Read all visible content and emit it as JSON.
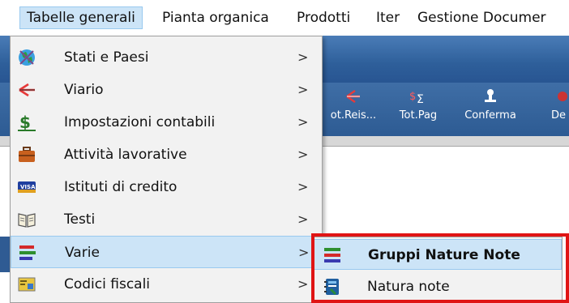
{
  "menubar": {
    "items": [
      {
        "label": "Tabelle generali"
      },
      {
        "label": "Pianta organica"
      },
      {
        "label": "Prodotti"
      },
      {
        "label": "Iter"
      },
      {
        "label": "Gestione Documer"
      }
    ]
  },
  "toolbar": {
    "buttons": [
      {
        "label": "ot.Reis...",
        "icon": "fork-arrow-icon"
      },
      {
        "label": "Tot.Pag",
        "icon": "dollar-sigma-icon"
      },
      {
        "label": "Conferma",
        "icon": "stamp-icon"
      },
      {
        "label": "De",
        "icon": "generic-icon"
      }
    ]
  },
  "main_menu": {
    "items": [
      {
        "label": "Stati e Paesi",
        "icon": "globe-icon",
        "arrow": ">"
      },
      {
        "label": "Viario",
        "icon": "road-junction-icon",
        "arrow": ">"
      },
      {
        "label": "Impostazioni contabili",
        "icon": "dollar-icon",
        "arrow": ">"
      },
      {
        "label": "Attività lavorative",
        "icon": "briefcase-icon",
        "arrow": ">"
      },
      {
        "label": "Istituti di credito",
        "icon": "credit-card-icon",
        "arrow": ">"
      },
      {
        "label": "Testi",
        "icon": "open-book-icon",
        "arrow": ">"
      },
      {
        "label": "Varie",
        "icon": "colored-bars-icon",
        "arrow": ">"
      },
      {
        "label": "Codici fiscali",
        "icon": "tax-code-card-icon",
        "arrow": ">"
      }
    ]
  },
  "submenu": {
    "items": [
      {
        "label": "Gruppi Nature Note",
        "icon": "colored-bars-icon"
      },
      {
        "label": "Natura note",
        "icon": "notebook-icon"
      }
    ]
  },
  "colors": {
    "highlight": "#cce4f7",
    "highlight_border": "#99c9ef",
    "annotation_frame": "#e01515",
    "toolbar_blue": "#2e5f9a"
  }
}
